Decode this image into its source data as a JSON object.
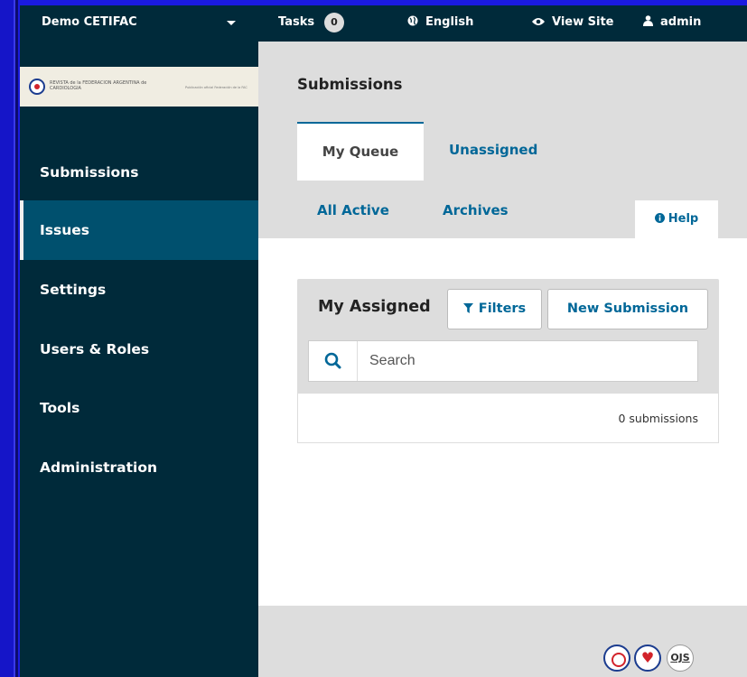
{
  "topbar": {
    "context_name": "Demo CETIFAC",
    "tasks_label": "Tasks",
    "tasks_count": "0",
    "language_label": "English",
    "view_site_label": "View Site",
    "user_label": "admin"
  },
  "sidebar": {
    "logo_text": "REVISTA de la FEDERACION ARGENTINA de CARDIOLOGIA",
    "logo_subtext": "Publicación oficial Federación de la FAC",
    "items": [
      {
        "label": "Submissions",
        "active": false
      },
      {
        "label": "Issues",
        "active": true
      },
      {
        "label": "Settings",
        "active": false
      },
      {
        "label": "Users & Roles",
        "active": false
      },
      {
        "label": "Tools",
        "active": false
      },
      {
        "label": "Administration",
        "active": false
      }
    ]
  },
  "main": {
    "page_title": "Submissions",
    "tabs": [
      {
        "label": "My Queue",
        "active": true
      },
      {
        "label": "Unassigned",
        "active": false
      },
      {
        "label": "All Active",
        "active": false
      },
      {
        "label": "Archives",
        "active": false
      }
    ],
    "help_label": "Help",
    "panel": {
      "title": "My Assigned",
      "filters_label": "Filters",
      "new_submission_label": "New Submission",
      "search_placeholder": "Search",
      "count_text": "0 submissions"
    },
    "footer_logos": [
      "fac-seal-logo",
      "heart-logo",
      "ojs-logo"
    ],
    "footer_ojs_text": "OJS"
  },
  "colors": {
    "desktop": "#1a1ae0",
    "sidebar_bg": "#002a3a",
    "active_item_bg": "#00506e",
    "link": "#006798"
  }
}
